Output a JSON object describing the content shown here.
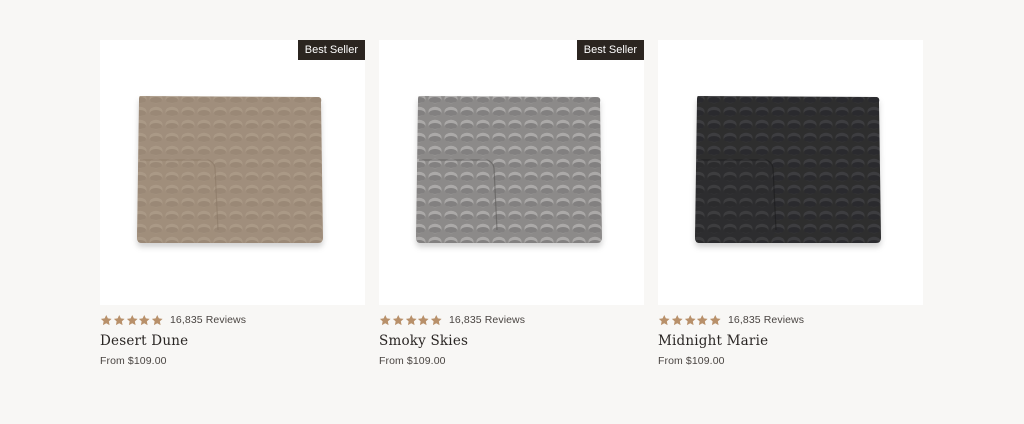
{
  "colors": {
    "background": "#f8f7f5",
    "star": "#b8906a",
    "badge_bg": "#2b2520",
    "badge_text": "#ffffff"
  },
  "products": [
    {
      "name": "Desert Dune",
      "badge": "Best Seller",
      "rating": 5,
      "reviews": "16,835 Reviews",
      "price": "From $109.00",
      "swatch": "#a08e7b",
      "swatch_dark": "#8a7866",
      "swatch_light": "#b3a290"
    },
    {
      "name": "Smoky Skies",
      "badge": "Best Seller",
      "rating": 5,
      "reviews": "16,835 Reviews",
      "price": "From $109.00",
      "swatch": "#8c8a89",
      "swatch_dark": "#5a5857",
      "swatch_light": "#c4c2c1"
    },
    {
      "name": "Midnight Marie",
      "badge": "",
      "rating": 5,
      "reviews": "16,835 Reviews",
      "price": "From $109.00",
      "swatch": "#2d2d2f",
      "swatch_dark": "#1a1a1c",
      "swatch_light": "#4a4a4d"
    }
  ]
}
